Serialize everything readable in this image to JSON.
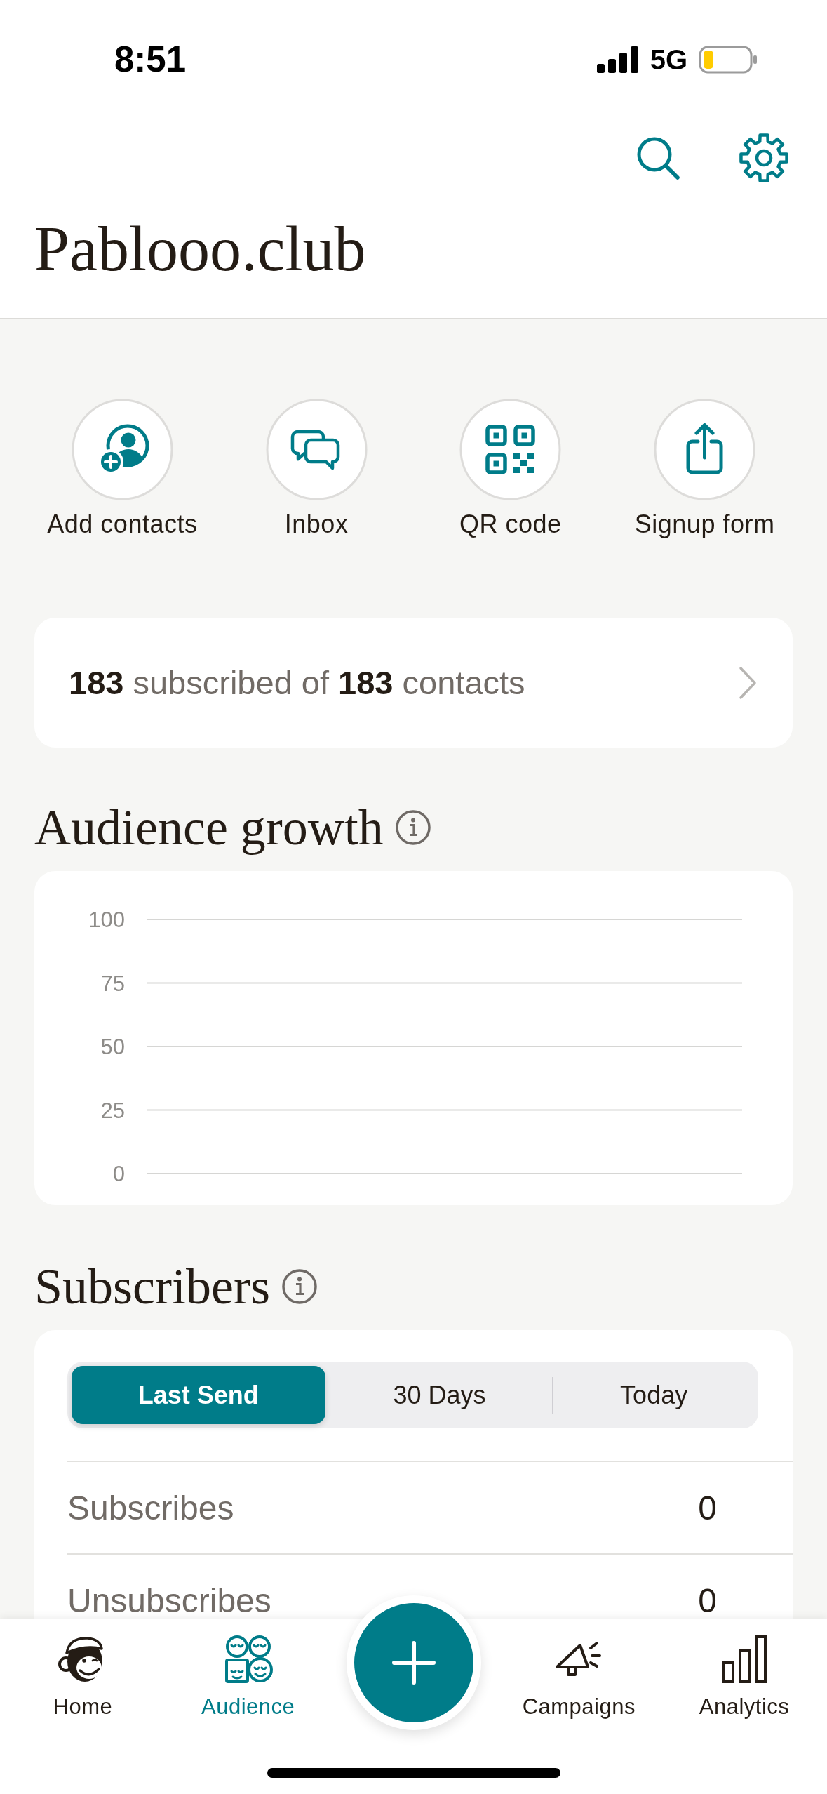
{
  "status_bar": {
    "time": "8:51",
    "network": "5G"
  },
  "header": {
    "title": "Pablooo.club"
  },
  "quick_actions": [
    {
      "label": "Add contacts"
    },
    {
      "label": "Inbox"
    },
    {
      "label": "QR code"
    },
    {
      "label": "Signup form"
    }
  ],
  "summary": {
    "text": "**183** subscribed of **183** contacts"
  },
  "audience_growth": {
    "title": "Audience growth",
    "chart_data": {
      "type": "line",
      "grid": true,
      "categories": [
        null,
        null
      ],
      "ylim": [
        0,
        100
      ],
      "yticks": [
        {
          "value": 0,
          "label": "0"
        },
        {
          "value": 25,
          "label": "25"
        },
        {
          "value": 50,
          "label": "50"
        },
        {
          "value": 75,
          "label": "75"
        },
        {
          "value": 100,
          "label": "100"
        }
      ]
    }
  },
  "subscribers": {
    "title": "Subscribers",
    "segments": [
      {
        "label": "Last Send",
        "selected": true
      },
      {
        "label": "30 Days",
        "selected": false
      },
      {
        "label": "Today",
        "selected": false
      }
    ],
    "rows": [
      {
        "label": "Subscribes",
        "value": "0"
      },
      {
        "label": "Unsubscribes",
        "value": "0"
      }
    ]
  },
  "bottom_nav": {
    "items": [
      {
        "label": "Home",
        "selected": false
      },
      {
        "label": "Audience",
        "selected": true
      },
      {
        "label": "Campaigns",
        "selected": false
      },
      {
        "label": "Analytics",
        "selected": false
      }
    ]
  }
}
